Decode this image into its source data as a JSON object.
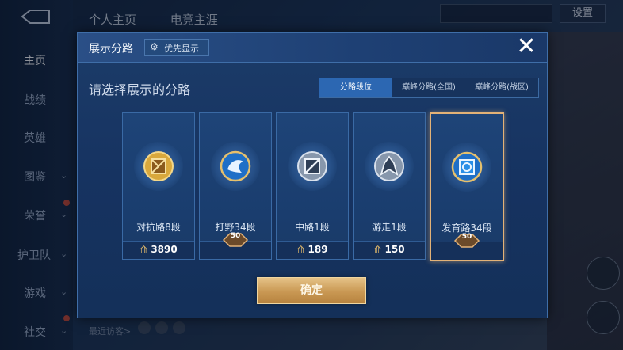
{
  "background": {
    "top_tabs": [
      "个人主页",
      "电竞主涯"
    ],
    "settings_label": "设置",
    "nav": [
      {
        "label": "主页",
        "active": true,
        "chevron": false
      },
      {
        "label": "战绩",
        "active": false,
        "chevron": false
      },
      {
        "label": "英雄",
        "active": false,
        "chevron": false
      },
      {
        "label": "图鉴",
        "active": false,
        "chevron": true
      },
      {
        "label": "荣誉",
        "active": false,
        "chevron": true
      },
      {
        "label": "护卫队",
        "active": false,
        "chevron": true
      },
      {
        "label": "游戏",
        "active": false,
        "chevron": true
      },
      {
        "label": "社交",
        "active": false,
        "chevron": true
      }
    ],
    "recent_visitors_label": "最近访客>"
  },
  "modal": {
    "title": "展示分路",
    "priority_button": "优先显示",
    "close_icon": "close-icon",
    "subtitle": "请选择展示的分路",
    "tabs": [
      {
        "label": "分路段位",
        "active": true
      },
      {
        "label": "巅峰分路(全国)",
        "active": false
      },
      {
        "label": "巅峰分路(战区)",
        "active": false
      }
    ],
    "cards": [
      {
        "name": "对抗路8段",
        "points": "3890",
        "stars": null,
        "selected": false,
        "icon": "clash-lane-badge-icon",
        "color": "#e1b64f"
      },
      {
        "name": "打野34段",
        "points": null,
        "stars": "50",
        "selected": false,
        "icon": "jungle-badge-icon",
        "color": "#4aa3e8"
      },
      {
        "name": "中路1段",
        "points": "189",
        "stars": null,
        "selected": false,
        "icon": "mid-lane-badge-icon",
        "color": "#a9b6c8"
      },
      {
        "name": "游走1段",
        "points": "150",
        "stars": null,
        "selected": false,
        "icon": "roam-badge-icon",
        "color": "#a9b6c8"
      },
      {
        "name": "发育路34段",
        "points": null,
        "stars": "50",
        "selected": true,
        "icon": "farm-lane-badge-icon",
        "color": "#4aa3e8"
      }
    ],
    "confirm_label": "确定"
  },
  "colors": {
    "accent_gold": "#e3b277",
    "active_tab": "#2c67b2",
    "modal_bg": "#1c3c69"
  }
}
